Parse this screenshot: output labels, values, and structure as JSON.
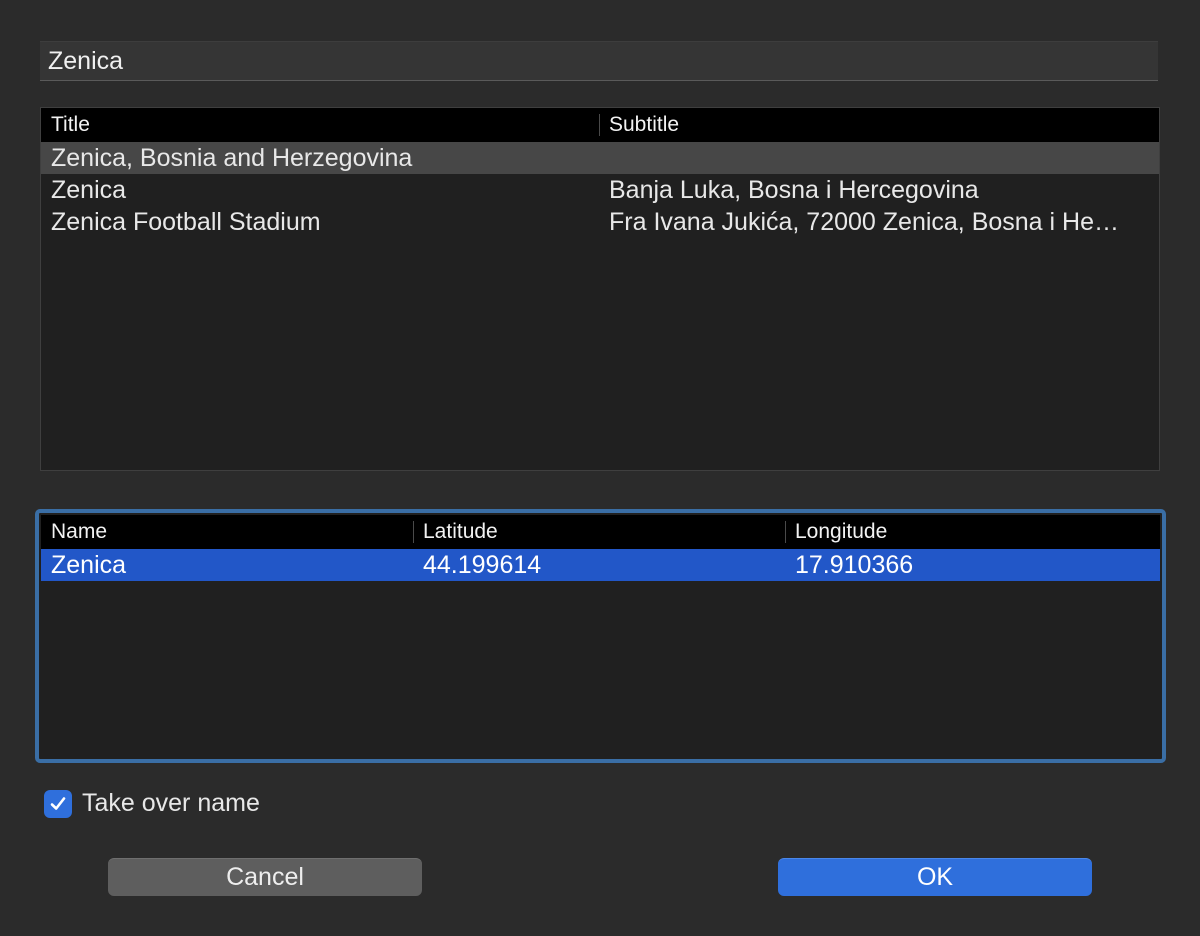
{
  "search": {
    "value": "Zenica"
  },
  "results": {
    "columns": [
      "Title",
      "Subtitle"
    ],
    "rows": [
      {
        "title": "Zenica, Bosnia and Herzegovina",
        "subtitle": ""
      },
      {
        "title": "Zenica",
        "subtitle": "Banja Luka, Bosna i Hercegovina"
      },
      {
        "title": "Zenica Football Stadium",
        "subtitle": "Fra Ivana Jukića, 72000 Zenica, Bosna i He…"
      }
    ]
  },
  "coordinates": {
    "columns": [
      "Name",
      "Latitude",
      "Longitude"
    ],
    "rows": [
      {
        "name": "Zenica",
        "latitude": "44.199614",
        "longitude": "17.910366"
      }
    ]
  },
  "take_over_name": {
    "label": "Take over name",
    "checked": true
  },
  "buttons": {
    "cancel_label": "Cancel",
    "ok_label": "OK"
  },
  "colors": {
    "accent": "#2f6fdc",
    "selection_blue": "#2257c8",
    "focus_ring": "#3a6ea5",
    "background": "#2b2b2b"
  },
  "icons": {
    "checkbox": "checkmark-icon"
  }
}
